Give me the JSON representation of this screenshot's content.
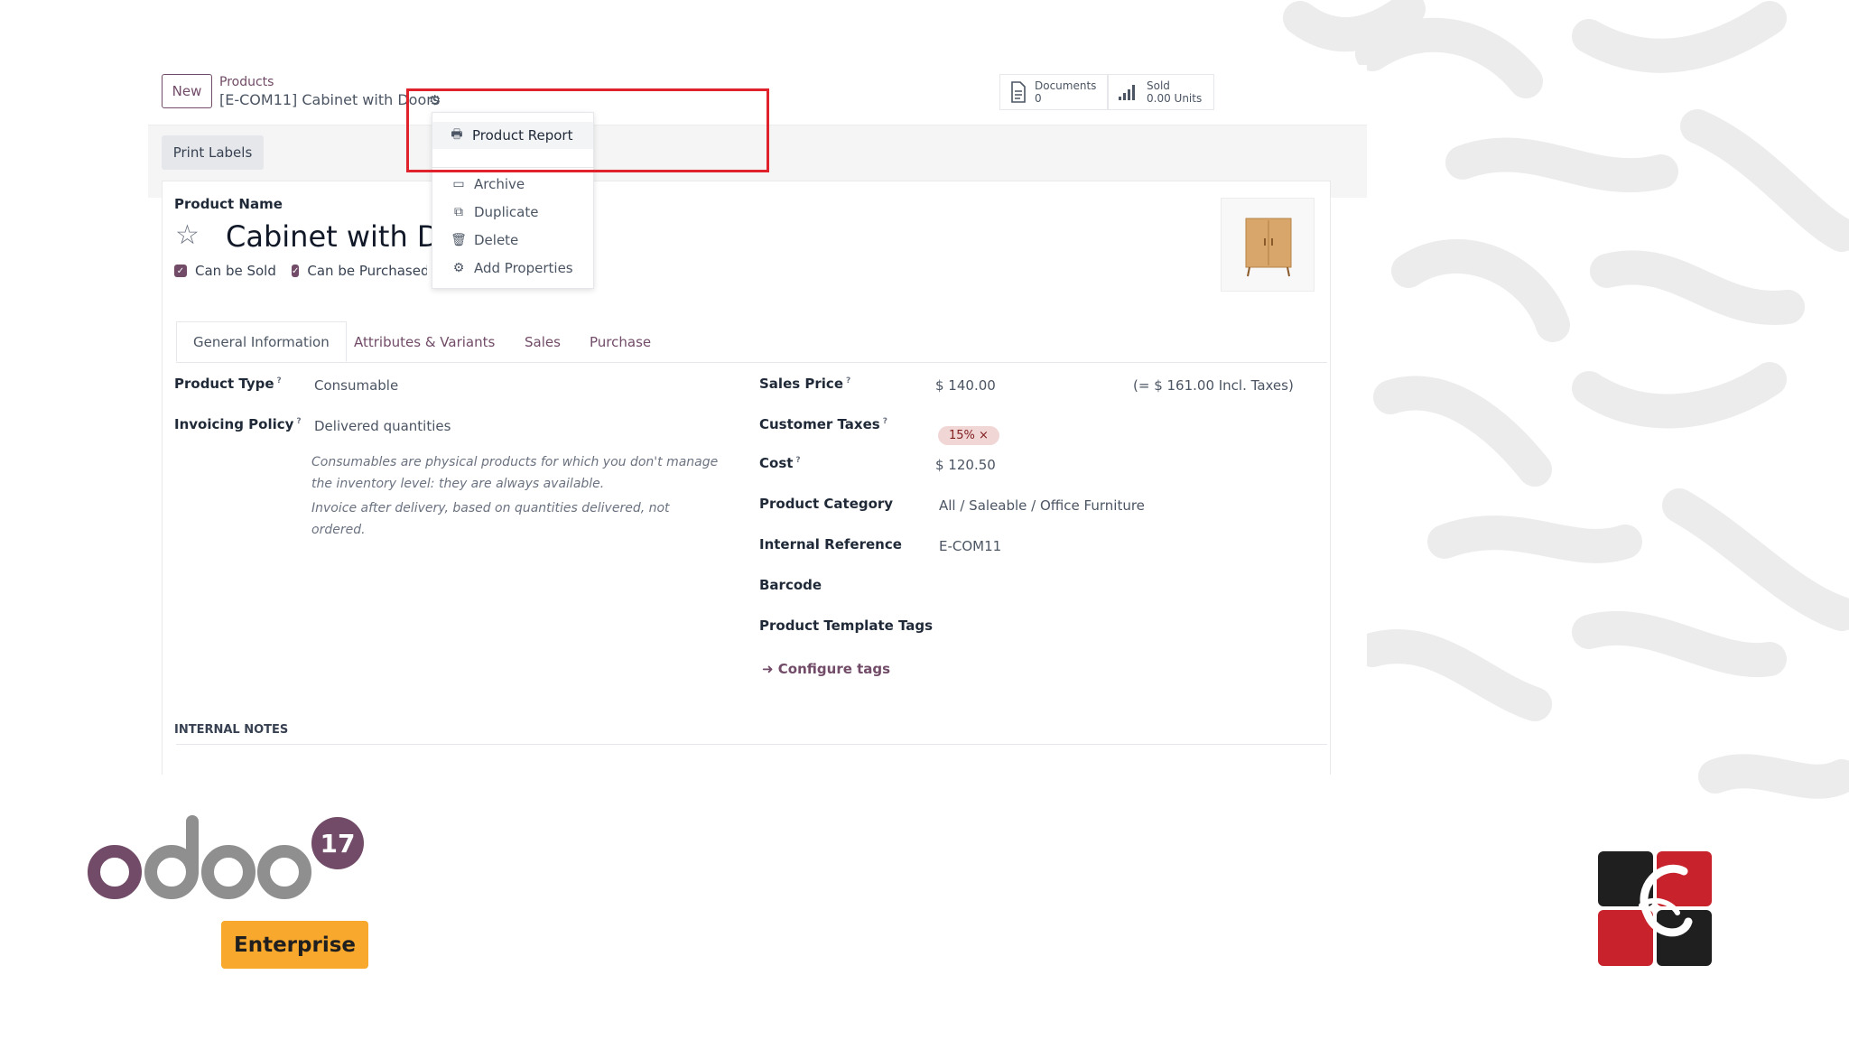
{
  "control_panel": {
    "new_button": "New",
    "breadcrumb_parent": "Products",
    "breadcrumb_current": "[E-COM11] Cabinet with Doors",
    "stats": [
      {
        "label": "Documents",
        "value": "0",
        "icon": "document-icon"
      },
      {
        "label": "Sold",
        "value": "0.00 Units",
        "icon": "bar-chart-icon"
      }
    ]
  },
  "gear_menu": {
    "items": [
      {
        "label": "Product Report",
        "icon": "printer-icon"
      },
      {
        "label": "Archive",
        "icon": "archive-icon"
      },
      {
        "label": "Duplicate",
        "icon": "copy-icon"
      },
      {
        "label": "Delete",
        "icon": "trash-icon"
      },
      {
        "label": "Add Properties",
        "icon": "cogs-icon"
      }
    ]
  },
  "status_bar": {
    "print_labels": "Print Labels"
  },
  "form": {
    "product_name_label": "Product Name",
    "product_name": "Cabinet with Doors",
    "can_be_sold": "Can be Sold",
    "can_be_purchased": "Can be Purchased",
    "tabs": [
      "General Information",
      "Attributes & Variants",
      "Sales",
      "Purchase"
    ],
    "left": {
      "product_type_label": "Product Type",
      "product_type": "Consumable",
      "invoicing_policy_label": "Invoicing Policy",
      "invoicing_policy": "Delivered quantities",
      "help_consumable": "Consumables are physical products for which you don't manage the inventory level: they are always available.",
      "help_invoice": "Invoice after delivery, based on quantities delivered, not ordered."
    },
    "right": {
      "sales_price_label": "Sales Price",
      "sales_price": "$ 140.00",
      "sales_price_incl": "(= $ 161.00 Incl. Taxes)",
      "customer_taxes_label": "Customer Taxes",
      "customer_taxes_tag": "15% ×",
      "cost_label": "Cost",
      "cost": "$ 120.50",
      "category_label": "Product Category",
      "category": "All / Saleable / Office Furniture",
      "internal_ref_label": "Internal Reference",
      "internal_ref": "E-COM11",
      "barcode_label": "Barcode",
      "tags_label": "Product Template Tags",
      "configure_tags": "Configure tags"
    },
    "internal_notes": "INTERNAL NOTES"
  },
  "branding": {
    "odoo_text": "odoo",
    "version": "17",
    "edition": "Enterprise",
    "colors": {
      "odoo_purple": "#714b67",
      "odoo_grey": "#8f8f8f",
      "enterprise_orange": "#f7a82d",
      "highlight_red": "#e0222c"
    }
  }
}
